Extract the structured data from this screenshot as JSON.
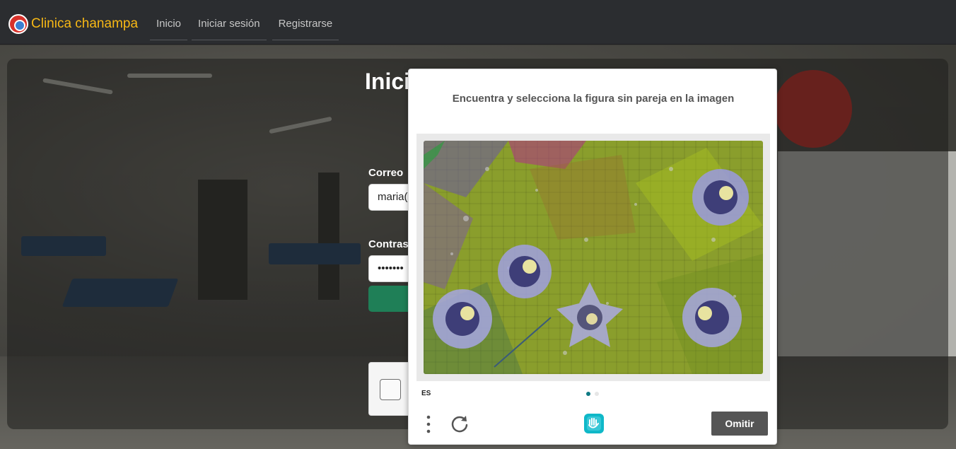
{
  "navbar": {
    "brand": "Clinica chanampa",
    "links": [
      "Inicio",
      "Iniciar sesión",
      "Registrarse"
    ]
  },
  "login": {
    "title": "Inici",
    "email_label": "Correo",
    "email_value": "maria(",
    "password_label": "Contras",
    "password_value": "•••••••"
  },
  "captcha": {
    "prompt": "Encuentra y selecciona la figura sin pareja en la imagen",
    "language": "ES",
    "skip_label": "Omitir",
    "page_total": 2,
    "page_current": 1
  },
  "colors": {
    "brand": "#f7b815",
    "navbar_bg": "#2b2d30",
    "submit_green": "#1f7f57",
    "captcha_accent": "#0f7a84",
    "skip_bg": "#555555"
  },
  "icons": [
    "brand-logo-icon",
    "menu-dots-icon",
    "refresh-icon",
    "hcaptcha-logo-icon"
  ]
}
